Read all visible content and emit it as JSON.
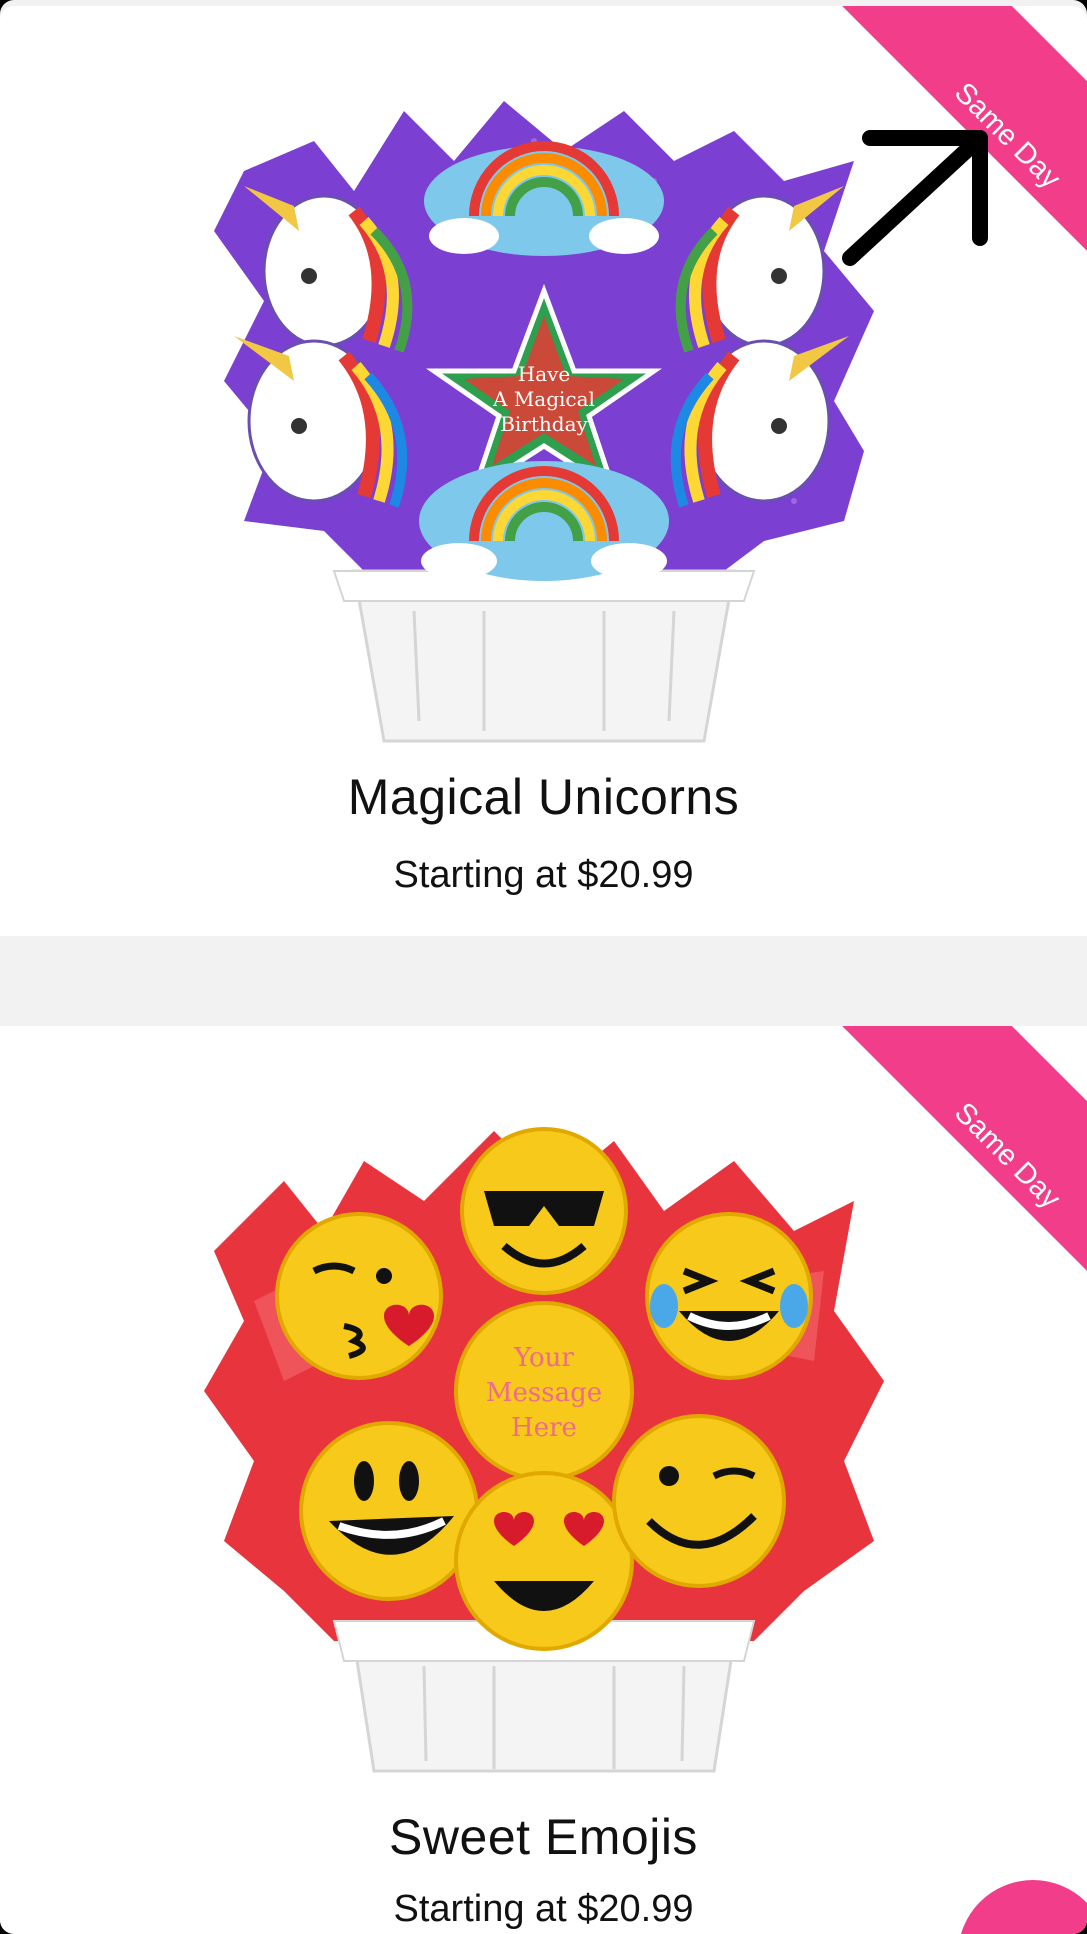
{
  "colors": {
    "accent": "#f23d8a",
    "background": "#f2f2f2",
    "card": "#ffffff"
  },
  "products": [
    {
      "name": "Magical Unicorns",
      "price": "Starting at $20.99",
      "badge": "Same Day",
      "image_icon": "unicorn-cookie-bouquet",
      "cookie_text": "Have A Magical Birthday"
    },
    {
      "name": "Sweet Emojis",
      "price": "Starting at $20.99",
      "badge": "Same Day",
      "image_icon": "emoji-cookie-bouquet",
      "cookie_text": "Your Message Here"
    }
  ],
  "annotation": {
    "icon": "arrow-up-right-icon"
  },
  "floating_button": {
    "icon": "cart-fab"
  }
}
